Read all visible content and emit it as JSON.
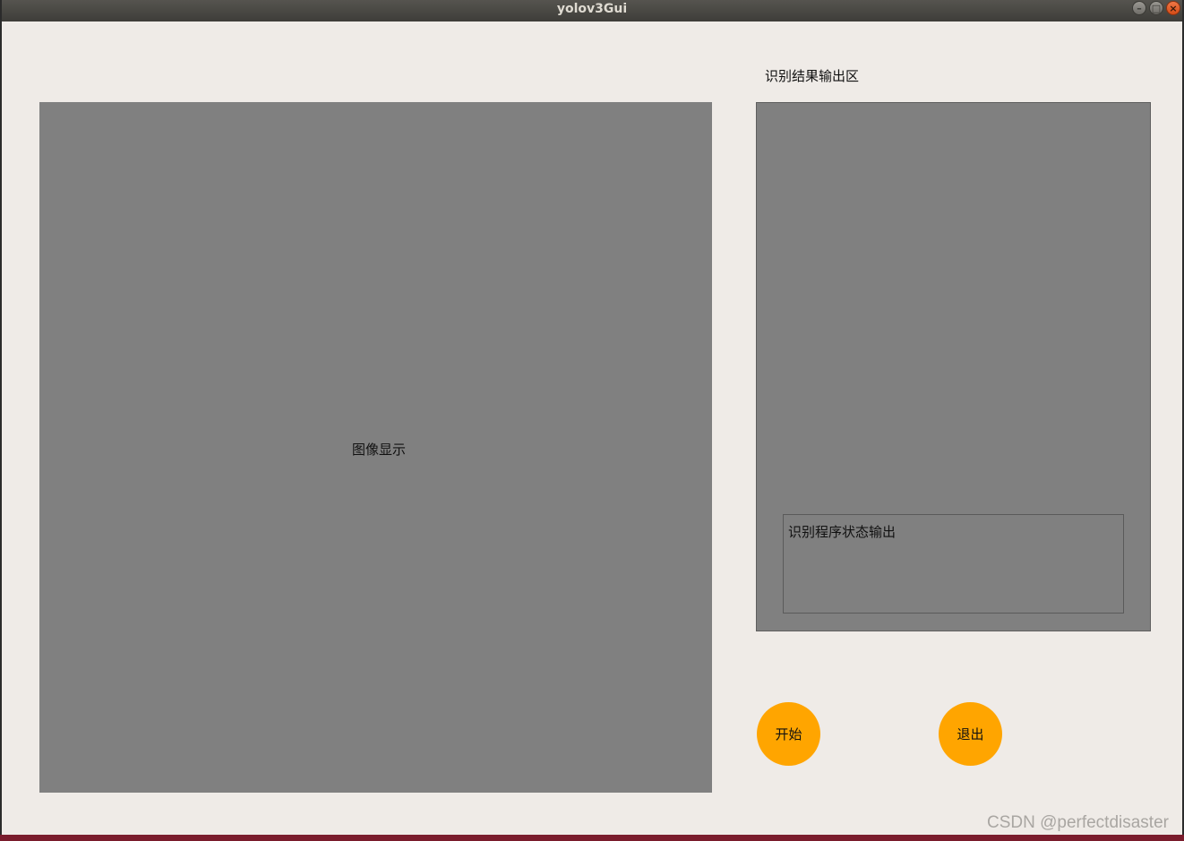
{
  "window": {
    "title": "yolov3Gui",
    "controls": {
      "minimize_icon": "–",
      "maximize_icon": "□",
      "close_icon": "×"
    }
  },
  "labels": {
    "image_display": "图像显示",
    "result_output_title": "识别结果输出区",
    "status_output": "识别程序状态输出"
  },
  "buttons": {
    "start": "开始",
    "exit": "退出"
  },
  "colors": {
    "panel_gray": "#808080",
    "button_orange": "#ffa500",
    "window_bg": "#efebe7"
  },
  "watermark": "CSDN @perfectdisaster"
}
